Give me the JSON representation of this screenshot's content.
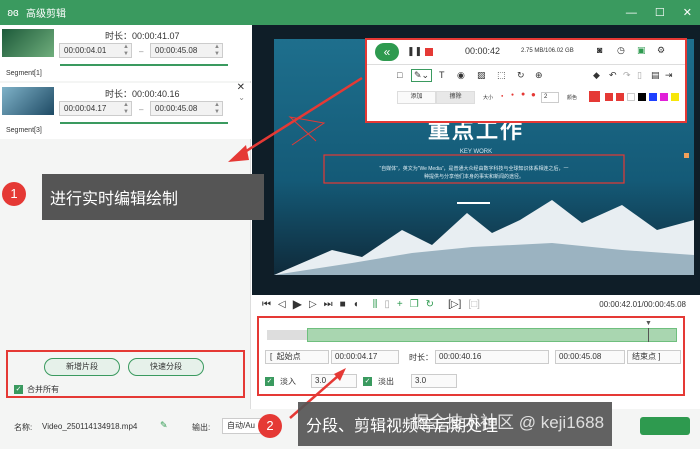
{
  "window": {
    "title": "高级剪辑",
    "minimize": "—",
    "restore": "☐",
    "close": "✕"
  },
  "segments": [
    {
      "label": "Segment[1]",
      "duration_label": "时长：00:00:41.07",
      "start": "00:00:04.01",
      "end": "00:00:45.08"
    },
    {
      "label": "Segment[3]",
      "duration_label": "时长：00:00:40.16",
      "start": "00:00:04.17",
      "end": "00:00:45.08"
    }
  ],
  "left_panel": {
    "add_segment": "新增片段",
    "quick_split": "快速分段",
    "merge_all": "合并所有"
  },
  "footer": {
    "name_label": "名称:",
    "file_name": "Video_250114134918.mp4",
    "output_label": "输出:",
    "output_value": "自动/Au"
  },
  "recorder": {
    "time": "00:00:42",
    "size": "2.75 MB/106.02 GB",
    "tab_add": "添加",
    "tab_clear": "擦除",
    "size_label": "大小",
    "size_value": "2",
    "color_label": "颜色",
    "swatches": [
      "#e53935",
      "#e53935",
      "#ffffff",
      "#000000",
      "#1e40ff",
      "#e11fd8",
      "#f7e60a"
    ]
  },
  "video": {
    "heading": "重点工作",
    "subheading": "KEY WORK",
    "line1": "“自媒体”，英文为“We Media”，是普通大众经由数字科技与全球知识体系相连之后，一",
    "line2": "种提供与分享他们本身的事实和新闻的途径。"
  },
  "playback": {
    "time": "00:00:42.01/00:00:45.08"
  },
  "timeline": {
    "start_label": "起始点",
    "start_value": "00:00:04.17",
    "duration_label": "时长：",
    "duration_value": "00:00:40.16",
    "end_value": "00:00:45.08",
    "end_label": "结束点",
    "fade_in_label": "淡入",
    "fade_in_value": "3.0",
    "fade_out_label": "淡出",
    "fade_out_value": "3.0"
  },
  "callouts": [
    {
      "number": "1",
      "text": "进行实时编辑绘制"
    },
    {
      "number": "2",
      "text": "分段、剪辑视频等后期处理"
    }
  ],
  "watermark": "掘金技术社区 @ keji1688"
}
